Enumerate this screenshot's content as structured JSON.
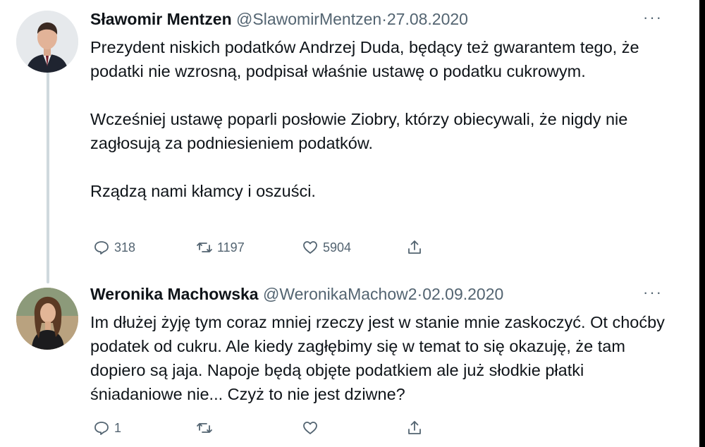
{
  "tweets": [
    {
      "name": "Sławomir Mentzen",
      "handle": "@SlawomirMentzen",
      "separator": "·",
      "date": "27.08.2020",
      "more": "···",
      "paragraphs": [
        "Prezydent niskich podatków Andrzej Duda, będący też gwarantem tego, że podatki nie wzrosną, podpisał właśnie ustawę o podatku cukrowym.",
        "Wcześniej ustawę poparli posłowie Ziobry, którzy obiecywali, że nigdy nie zagłosują za podniesieniem podatków.",
        "Rządzą nami kłamcy i oszuści."
      ],
      "actions": {
        "replies": "318",
        "retweets": "1197",
        "likes": "5904",
        "share": ""
      }
    },
    {
      "name": "Weronika Machowska",
      "handle": "@WeronikaMachow2",
      "separator": "·",
      "date": "02.09.2020",
      "more": "···",
      "paragraphs": [
        "Im dłużej żyję tym coraz mniej rzeczy jest w stanie mnie zaskoczyć. Ot choćby podatek od cukru. Ale kiedy zagłębimy się w temat to się okazuję, że tam dopiero są jaja. Napoje będą objęte podatkiem ale już słodkie płatki śniadaniowe nie... Czyż to nie jest dziwne?"
      ],
      "actions": {
        "replies": "1",
        "retweets": "",
        "likes": "",
        "share": ""
      }
    }
  ],
  "colors": {
    "text": "#0f1419",
    "muted": "#536471",
    "thread_line": "#cfd9de",
    "background": "#ffffff"
  },
  "icons": [
    "reply-icon",
    "retweet-icon",
    "like-icon",
    "share-icon"
  ]
}
